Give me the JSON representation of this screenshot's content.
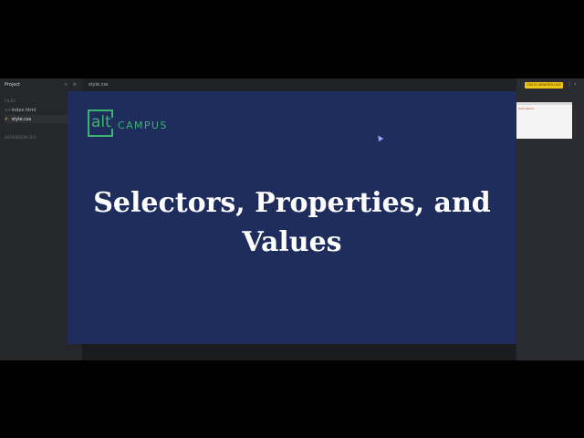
{
  "sidebar": {
    "title": "Project",
    "tool_icons": "+ ⚙",
    "files_label": "FILES",
    "files": [
      {
        "icon": "<>",
        "name": "index.html",
        "icon_name": "html-file-icon"
      },
      {
        "icon": "#",
        "name": "style.css",
        "icon_name": "css-file-icon"
      }
    ],
    "dependencies_label": "DEPENDENCIES"
  },
  "editor": {
    "active_tab": "style.css"
  },
  "preview_panel": {
    "badge": "CSS IS UPDATED LIVE",
    "preview_text": "Hello World"
  },
  "slide": {
    "logo_alt": "alt",
    "logo_campus": "CAMPUS",
    "title_line1": "Selectors, Properties, and",
    "title_line2": "Values"
  },
  "colors": {
    "slide_bg": "#1f2d5c",
    "brand_green": "#3cb371",
    "badge_yellow": "#f0c419"
  }
}
